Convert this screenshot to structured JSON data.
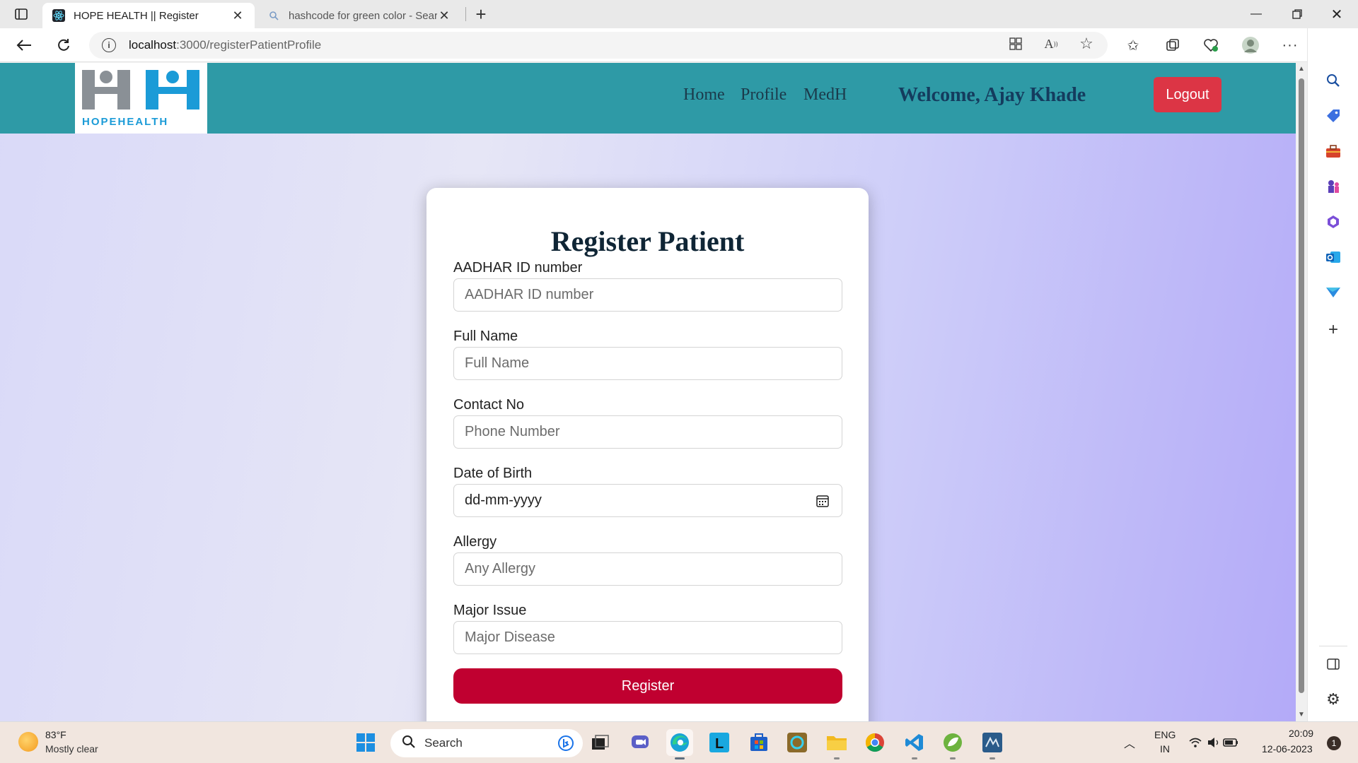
{
  "browser": {
    "tabs": [
      {
        "title": "HOPE HEALTH || Register",
        "active": true
      },
      {
        "title": "hashcode for green color - Searc",
        "active": false
      }
    ],
    "url_host": "localhost",
    "url_path": ":3000/registerPatientProfile"
  },
  "site": {
    "logo_text": "HOPEHEALTH",
    "nav": {
      "home": "Home",
      "profile": "Profile",
      "medh": "MedH"
    },
    "welcome": "Welcome, Ajay Khade",
    "logout": "Logout"
  },
  "form": {
    "title": "Register Patient",
    "aadhar": {
      "label": "AADHAR ID number",
      "placeholder": "AADHAR ID number"
    },
    "full_name": {
      "label": "Full Name",
      "placeholder": "Full Name"
    },
    "contact": {
      "label": "Contact No",
      "placeholder": "Phone Number"
    },
    "dob": {
      "label": "Date of Birth",
      "value": "dd-mm-yyyy"
    },
    "allergy": {
      "label": "Allergy",
      "placeholder": "Any Allergy"
    },
    "major_issue": {
      "label": "Major Issue",
      "placeholder": "Major Disease"
    },
    "submit": "Register"
  },
  "taskbar": {
    "weather_temp": "83°F",
    "weather_desc": "Mostly clear",
    "search": "Search",
    "lang_top": "ENG",
    "lang_bottom": "IN",
    "time": "20:09",
    "date": "12-06-2023",
    "notifications": "1"
  },
  "colors": {
    "navbar": "#2e9aa6",
    "logout": "#dc3545",
    "register_button": "#c00030",
    "welcome_text": "#143c5e"
  }
}
